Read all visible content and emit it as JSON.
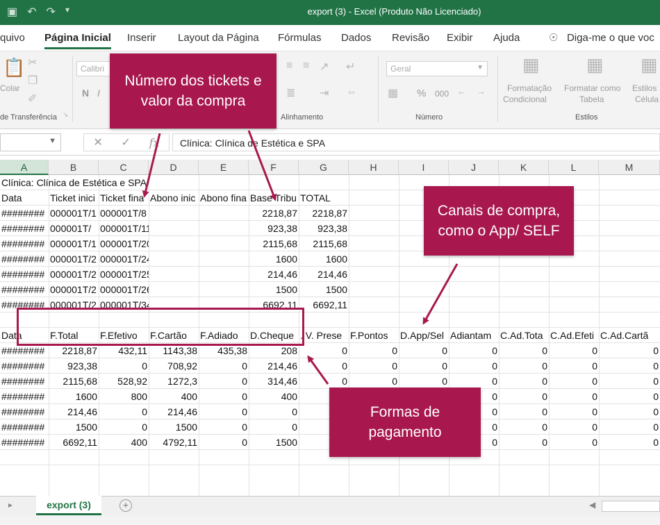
{
  "title_bar": {
    "document_title": "export (3)  -  Excel (Produto Não Licenciado)"
  },
  "ribbon_tabs": [
    "quivo",
    "Página Inicial",
    "Inserir",
    "Layout da Página",
    "Fórmulas",
    "Dados",
    "Revisão",
    "Exibir",
    "Ajuda"
  ],
  "tell_me": "Diga-me o que voc",
  "ribbon": {
    "font_name": "Calibri",
    "paste_label": "Colar",
    "bold": "N",
    "italic": "I",
    "number_format": "Geral",
    "percent": "%",
    "thousands": "000",
    "cond_format_line1": "Formatação",
    "cond_format_line2": "Condicional",
    "format_table_line1": "Formatar como",
    "format_table_line2": "Tabela",
    "cell_styles_line1": "Estilos",
    "cell_styles_line2": "Célula",
    "groups": {
      "clipboard": "de Transferência",
      "alignment": "Alinhamento",
      "number": "Número",
      "styles": "Estilos"
    }
  },
  "formula_bar": {
    "fx": "fx",
    "content": "Clínica: Clínica de Estética e SPA"
  },
  "columns": [
    "A",
    "B",
    "C",
    "D",
    "E",
    "F",
    "G",
    "H",
    "I",
    "J",
    "K",
    "L",
    "M"
  ],
  "rows": [
    [
      "Clínica: Clínica de Estética e SPA",
      "",
      "",
      "",
      "",
      "",
      "",
      "",
      "",
      "",
      "",
      "",
      ""
    ],
    [
      "Data",
      "Ticket inici",
      "Ticket fina",
      "Abono inic",
      "Abono fina",
      "Base Tribu",
      "TOTAL",
      "",
      "",
      "",
      "",
      "",
      ""
    ],
    [
      "########",
      "000001T/1",
      "000001T/8",
      "",
      "",
      "2218,87",
      "2218,87",
      "",
      "",
      "",
      "",
      "",
      ""
    ],
    [
      "########",
      "000001T/",
      "000001T/11",
      "",
      "",
      "923,38",
      "923,38",
      "",
      "",
      "",
      "",
      "",
      ""
    ],
    [
      "########",
      "000001T/1",
      "000001T/20",
      "",
      "",
      "2115,68",
      "2115,68",
      "",
      "",
      "",
      "",
      "",
      ""
    ],
    [
      "########",
      "000001T/2",
      "000001T/24",
      "",
      "",
      "1600",
      "1600",
      "",
      "",
      "",
      "",
      "",
      ""
    ],
    [
      "########",
      "000001T/2",
      "000001T/25",
      "",
      "",
      "214,46",
      "214,46",
      "",
      "",
      "",
      "",
      "",
      ""
    ],
    [
      "########",
      "000001T/2",
      "000001T/26",
      "",
      "",
      "1500",
      "1500",
      "",
      "",
      "",
      "",
      "",
      ""
    ],
    [
      "########",
      "000001T/2",
      "000001T/34",
      "",
      "",
      "6692,11",
      "6692,11",
      "",
      "",
      "",
      "",
      "",
      ""
    ],
    [
      "",
      "",
      "",
      "",
      "",
      "",
      "",
      "",
      "",
      "",
      "",
      "",
      ""
    ],
    [
      "Data",
      "F.Total",
      "F.Efetivo",
      "F.Cartão",
      "F.Adiado",
      "D.Cheque",
      ". V. Prese",
      "F.Pontos",
      "D.App/Sel",
      "Adiantam",
      "C.Ad.Tota",
      "C.Ad.Efeti",
      "C.Ad.Cartã"
    ],
    [
      "########",
      "2218,87",
      "432,11",
      "1143,38",
      "435,38",
      "208",
      "0",
      "0",
      "0",
      "0",
      "0",
      "0",
      "0"
    ],
    [
      "########",
      "923,38",
      "0",
      "708,92",
      "0",
      "214,46",
      "0",
      "0",
      "0",
      "0",
      "0",
      "0",
      "0"
    ],
    [
      "########",
      "2115,68",
      "528,92",
      "1272,3",
      "0",
      "314,46",
      "0",
      "0",
      "0",
      "0",
      "0",
      "0",
      "0"
    ],
    [
      "########",
      "1600",
      "800",
      "400",
      "0",
      "400",
      "",
      "",
      "",
      "0",
      "0",
      "0",
      "0"
    ],
    [
      "########",
      "214,46",
      "0",
      "214,46",
      "0",
      "0",
      "",
      "",
      "",
      "0",
      "0",
      "0",
      "0"
    ],
    [
      "########",
      "1500",
      "0",
      "1500",
      "0",
      "0",
      "",
      "",
      "",
      "0",
      "0",
      "0",
      "0"
    ],
    [
      "########",
      "6692,11",
      "400",
      "4792,11",
      "0",
      "1500",
      "",
      "",
      "",
      "0",
      "0",
      "0",
      "0"
    ]
  ],
  "sheet_tab": "export (3)",
  "annotations": {
    "tickets": "Número dos tickets e valor da compra",
    "channels": "Canais de compra, como o App/ SELF",
    "payment": "Formas de pagamento"
  },
  "colors": {
    "excel_green": "#217346",
    "callout": "#a8184e"
  }
}
